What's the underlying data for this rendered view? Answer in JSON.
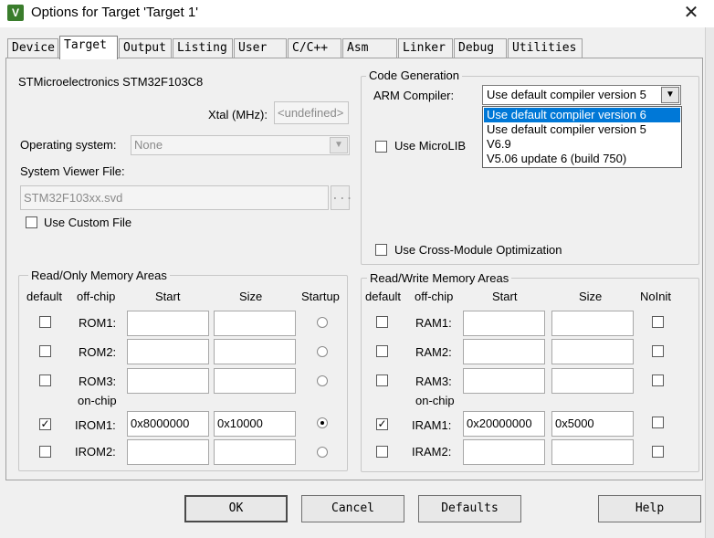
{
  "window": {
    "title": "Options for Target 'Target 1'"
  },
  "tabs": [
    {
      "label": "Device"
    },
    {
      "label": "Target"
    },
    {
      "label": "Output"
    },
    {
      "label": "Listing"
    },
    {
      "label": "User"
    },
    {
      "label": "C/C++"
    },
    {
      "label": "Asm"
    },
    {
      "label": "Linker"
    },
    {
      "label": "Debug"
    },
    {
      "label": "Utilities"
    }
  ],
  "device": {
    "name": "STMicroelectronics STM32F103C8"
  },
  "xtal": {
    "label": "Xtal (MHz):",
    "value": "<undefined>"
  },
  "os": {
    "label": "Operating system:",
    "value": "None"
  },
  "svd": {
    "label": "System Viewer File:",
    "value": "STM32F103xx.svd",
    "browse": "...",
    "custom_label": "Use Custom File",
    "custom_checked": false
  },
  "codegen": {
    "legend": "Code Generation",
    "compiler_label": "ARM Compiler:",
    "compiler_value": "Use default compiler version 5",
    "microlib_label": "Use MicroLIB",
    "cross_module_label": "Use Cross-Module Optimization",
    "options": [
      "Use default compiler version 6",
      "Use default compiler version 5",
      "V6.9",
      "V5.06 update 6 (build 750)"
    ]
  },
  "rom": {
    "legend": "Read/Only Memory Areas",
    "headers": {
      "default": "default",
      "offchip": "off-chip",
      "start": "Start",
      "size": "Size",
      "startup": "Startup"
    },
    "onchip_label": "on-chip",
    "rows": [
      {
        "label": "ROM1:",
        "default": false,
        "start": "",
        "size": "",
        "startup": false
      },
      {
        "label": "ROM2:",
        "default": false,
        "start": "",
        "size": "",
        "startup": false
      },
      {
        "label": "ROM3:",
        "default": false,
        "start": "",
        "size": "",
        "startup": false
      },
      {
        "label": "IROM1:",
        "default": true,
        "start": "0x8000000",
        "size": "0x10000",
        "startup": true
      },
      {
        "label": "IROM2:",
        "default": false,
        "start": "",
        "size": "",
        "startup": false
      }
    ]
  },
  "ram": {
    "legend": "Read/Write Memory Areas",
    "headers": {
      "default": "default",
      "offchip": "off-chip",
      "start": "Start",
      "size": "Size",
      "noinit": "NoInit"
    },
    "onchip_label": "on-chip",
    "rows": [
      {
        "label": "RAM1:",
        "default": false,
        "start": "",
        "size": "",
        "noinit": false
      },
      {
        "label": "RAM2:",
        "default": false,
        "start": "",
        "size": "",
        "noinit": false
      },
      {
        "label": "RAM3:",
        "default": false,
        "start": "",
        "size": "",
        "noinit": false
      },
      {
        "label": "IRAM1:",
        "default": true,
        "start": "0x20000000",
        "size": "0x5000",
        "noinit": false
      },
      {
        "label": "IRAM2:",
        "default": false,
        "start": "",
        "size": "",
        "noinit": false
      }
    ]
  },
  "buttons": {
    "ok": "OK",
    "cancel": "Cancel",
    "defaults": "Defaults",
    "help": "Help"
  },
  "icons": {
    "app": "keil-app-icon",
    "close": "close-icon",
    "dropdown": "chevron-down-icon",
    "check": "checkmark-icon"
  }
}
